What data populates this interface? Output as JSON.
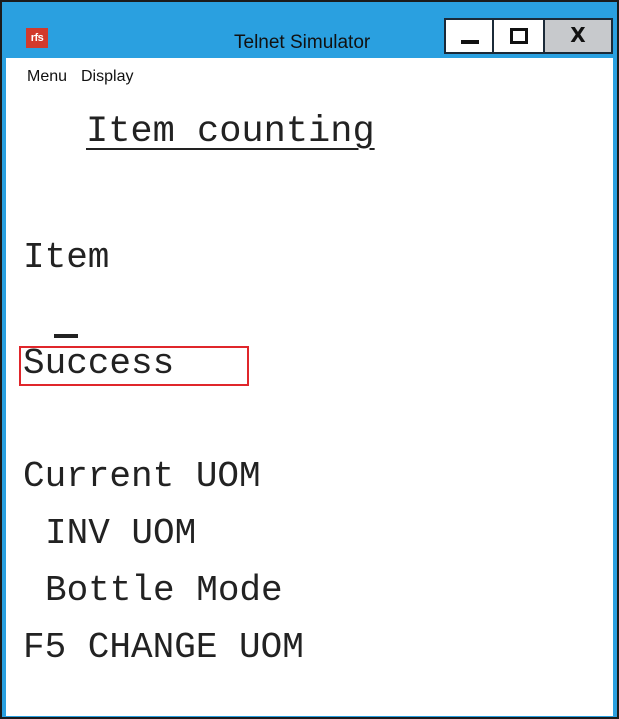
{
  "window": {
    "app_icon_label": "rfs",
    "title": "Telnet Simulator",
    "controls": {
      "minimize_icon": "minimize-icon",
      "maximize_icon": "maximize-icon",
      "close_label": "X"
    },
    "frame_color": "#2aa0e0"
  },
  "menubar": {
    "items": [
      {
        "label": "Menu"
      },
      {
        "label": "Display"
      }
    ]
  },
  "terminal": {
    "title": "Item counting",
    "item_label": "Item",
    "status": "Success",
    "status_highlight_color": "#e0262b",
    "current_uom_label": "Current UOM",
    "inv_uom": "INV UOM",
    "bottle_mode": "Bottle Mode",
    "f5_hint": "F5 CHANGE UOM"
  }
}
